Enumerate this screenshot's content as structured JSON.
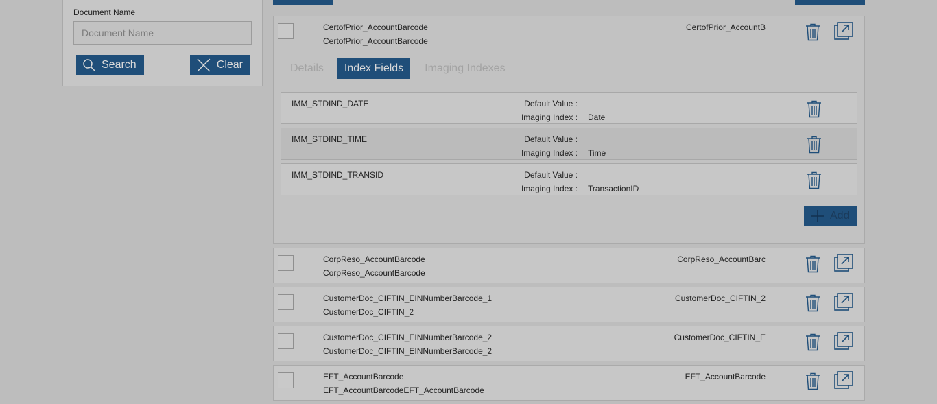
{
  "filter": {
    "label": "Document Name",
    "placeholder": "Document Name",
    "search_label": "Search",
    "clear_label": "Clear"
  },
  "expanded_doc": {
    "name": "CertofPrior_AccountBarcode",
    "sub": "CertofPrior_AccountBarcode",
    "right": "CertofPrior_AccountB",
    "tabs": [
      {
        "label": "Details",
        "active": false
      },
      {
        "label": "Index Fields",
        "active": true
      },
      {
        "label": "Imaging Indexes",
        "active": false
      }
    ],
    "fields": [
      {
        "name": "IMM_STDIND_DATE",
        "default_label": "Default Value :",
        "default_value": "",
        "imaging_label": "Imaging Index :",
        "imaging_value": "Date"
      },
      {
        "name": "IMM_STDIND_TIME",
        "default_label": "Default Value :",
        "default_value": "",
        "imaging_label": "Imaging Index :",
        "imaging_value": "Time"
      },
      {
        "name": "IMM_STDIND_TRANSID",
        "default_label": "Default Value :",
        "default_value": "",
        "imaging_label": "Imaging Index :",
        "imaging_value": "TransactionID"
      }
    ],
    "add_label": "Add"
  },
  "documents": [
    {
      "name": "CorpReso_AccountBarcode",
      "sub": "CorpReso_AccountBarcode",
      "right": "CorpReso_AccountBarc"
    },
    {
      "name": "CustomerDoc_CIFTIN_EINNumberBarcode_1",
      "sub": "CustomerDoc_CIFTIN_2",
      "right": "CustomerDoc_CIFTIN_2"
    },
    {
      "name": "CustomerDoc_CIFTIN_EINNumberBarcode_2",
      "sub": "CustomerDoc_CIFTIN_EINNumberBarcode_2",
      "right": "CustomerDoc_CIFTIN_E"
    },
    {
      "name": "EFT_AccountBarcode",
      "sub": "EFT_AccountBarcodeEFT_AccountBarcode",
      "right": "EFT_AccountBarcode"
    }
  ],
  "colors": {
    "overlay_background": "#bdbdbd",
    "accent": "#1f4e79"
  }
}
